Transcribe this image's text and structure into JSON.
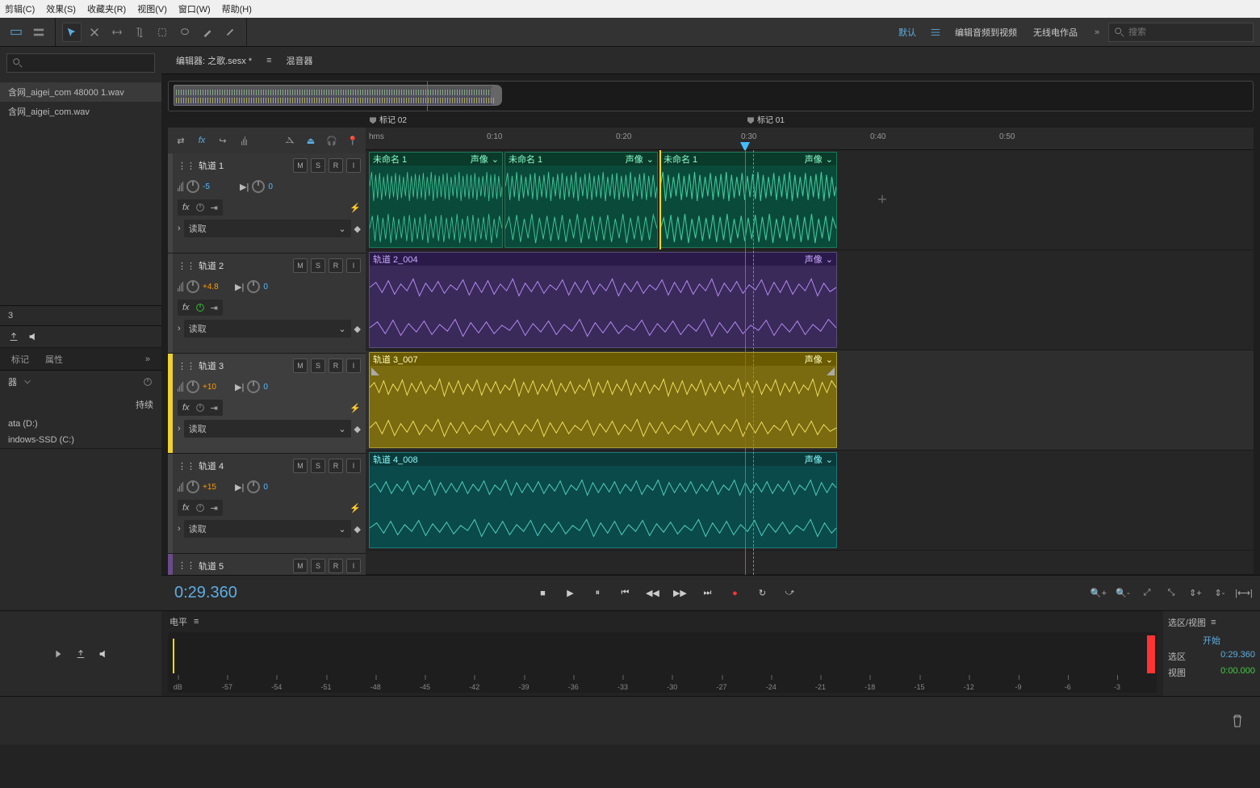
{
  "menu": {
    "edit": "剪辑(C)",
    "effect": "效果(S)",
    "fav": "收藏夹(R)",
    "view": "视图(V)",
    "window": "窗口(W)",
    "help": "帮助(H)"
  },
  "workspace": {
    "default": "默认",
    "editvideo": "编辑音频到视频",
    "radio": "无线电作品"
  },
  "search_placeholder": "搜索",
  "left": {
    "files": {
      "f1": "含网_aigei_com 48000 1.wav",
      "f2": "含网_aigei_com.wav"
    },
    "tabs": {
      "marker": "标记",
      "props": "属性"
    },
    "drop_label": "器",
    "persist": "持续",
    "drives": {
      "d1": "ata (D:)",
      "d2": "indows-SSD (C:)"
    },
    "three": "3"
  },
  "editor": {
    "tab1": "编辑器: 之歌.sesx *",
    "tab2": "混音器"
  },
  "markers": {
    "m1": "标记 02",
    "m2": "标记 01"
  },
  "ruler": {
    "unit": "hms",
    "t10": "0:10",
    "t20": "0:20",
    "t30": "0:30",
    "t40": "0:40",
    "t50": "0:50"
  },
  "tracks": {
    "t1": {
      "name": "轨道 1",
      "vol": "-5",
      "pan": "0",
      "read": "读取",
      "clip1": {
        "name": "未命名 1",
        "pan": "声像"
      },
      "clip2": {
        "name": "未命名 1",
        "pan": "声像"
      },
      "clip3": {
        "name": "未命名 1",
        "pan": "声像"
      }
    },
    "t2": {
      "name": "轨道 2",
      "vol": "+4.8",
      "pan": "0",
      "read": "读取",
      "clip": {
        "name": "轨道 2_004",
        "pan": "声像"
      }
    },
    "t3": {
      "name": "轨道 3",
      "vol": "+10",
      "pan": "0",
      "read": "读取",
      "clip": {
        "name": "轨道 3_007",
        "pan": "声像"
      }
    },
    "t4": {
      "name": "轨道 4",
      "vol": "+15",
      "pan": "0",
      "read": "读取",
      "clip": {
        "name": "轨道 4_008",
        "pan": "声像"
      }
    },
    "t5": {
      "name": "轨道 5"
    }
  },
  "msr": {
    "m": "M",
    "s": "S",
    "r": "R",
    "i": "I"
  },
  "fx_label": "fx",
  "timecode": "0:29.360",
  "levels": {
    "title": "电平",
    "unit": "dB",
    "scale": {
      "s57": "-57",
      "s54": "-54",
      "s51": "-51",
      "s48": "-48",
      "s45": "-45",
      "s42": "-42",
      "s39": "-39",
      "s36": "-36",
      "s33": "-33",
      "s30": "-30",
      "s27": "-27",
      "s24": "-24",
      "s21": "-21",
      "s18": "-18",
      "s15": "-15",
      "s12": "-12",
      "s9": "-9",
      "s6": "-6",
      "s3": "-3"
    }
  },
  "selview": {
    "title": "选区/视图",
    "start": "开始",
    "sel": "选区",
    "view": "视图",
    "selval": "0:29.360",
    "viewval": "0:00.000"
  }
}
